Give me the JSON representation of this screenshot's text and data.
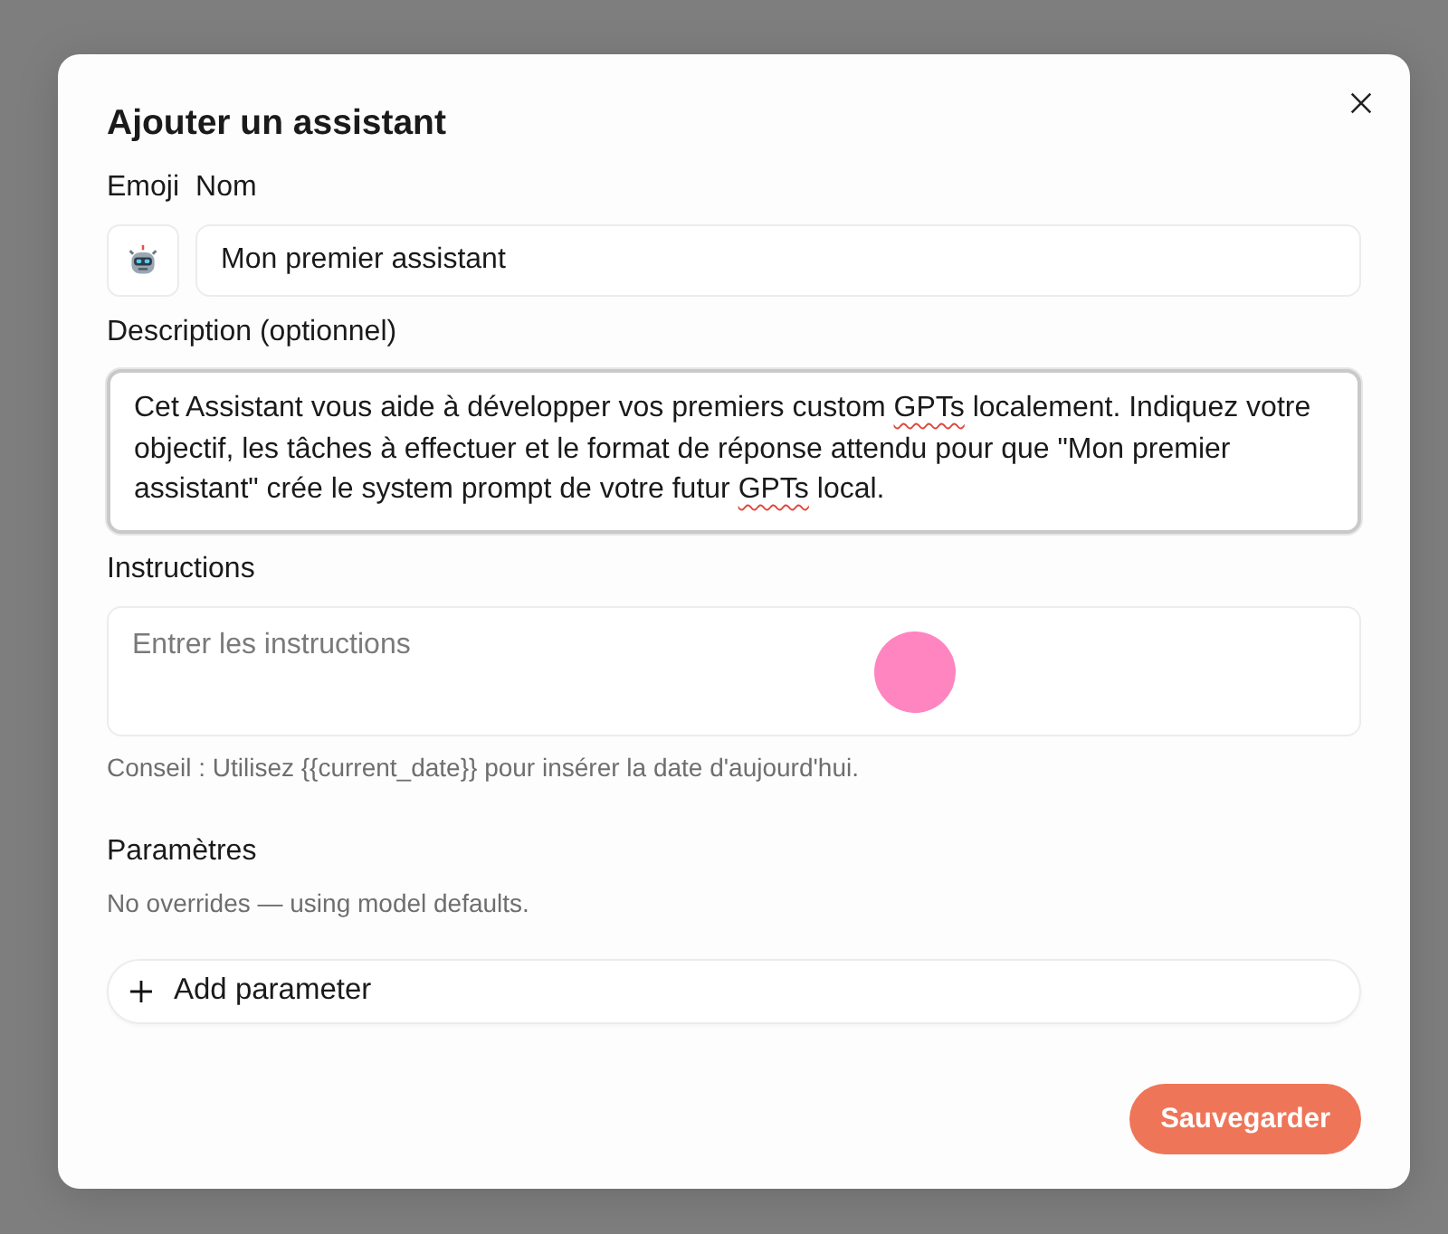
{
  "dialog": {
    "title": "Ajouter un assistant"
  },
  "identity": {
    "emoji_label": "Emoji",
    "name_label": "Nom",
    "name_value": "Mon premier assistant"
  },
  "description": {
    "label": "Description (optionnel)",
    "focused": true,
    "segments": [
      {
        "text": "Cet Assistant vous aide à développer vos premiers custom ",
        "misspelled": false
      },
      {
        "text": "GPTs",
        "misspelled": true
      },
      {
        "text": " localement. Indiquez votre objectif, les tâches à effectuer et le format de réponse attendu pour que \"Mon premier assistant\" crée le system prompt de votre futur ",
        "misspelled": false
      },
      {
        "text": "GPTs",
        "misspelled": true
      },
      {
        "text": " local.",
        "misspelled": false
      }
    ]
  },
  "instructions": {
    "label": "Instructions",
    "placeholder": "Entrer les instructions",
    "hint": "Conseil : Utilisez {{current_date}} pour insérer la date d'aujourd'hui."
  },
  "parameters": {
    "heading": "Paramètres",
    "status": "No overrides — using model defaults.",
    "add_button": "Add parameter"
  },
  "footer": {
    "save_button": "Sauvegarder"
  }
}
